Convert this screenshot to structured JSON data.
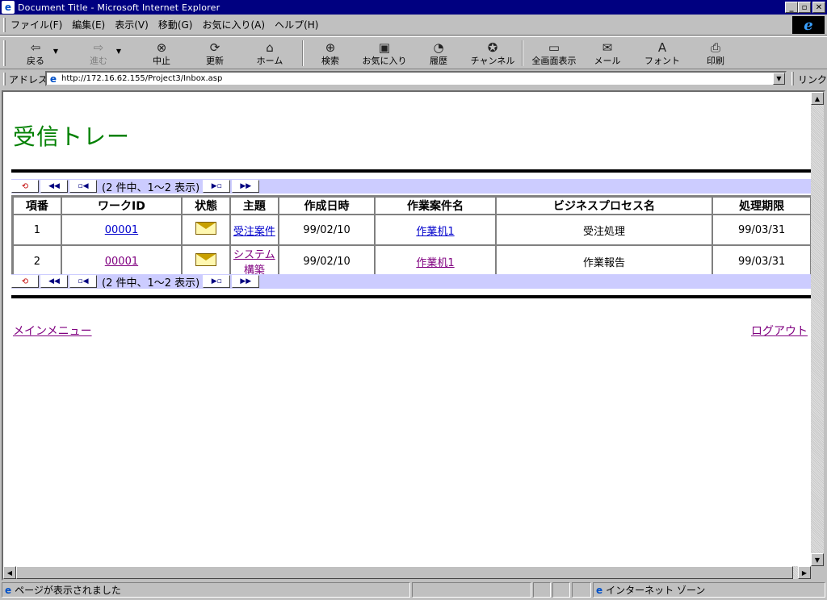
{
  "window": {
    "title": "Document Title - Microsoft Internet Explorer",
    "icon": "ie-icon"
  },
  "menubar": {
    "items": [
      "ファイル(F)",
      "編集(E)",
      "表示(V)",
      "移動(G)",
      "お気に入り(A)",
      "ヘルプ(H)"
    ]
  },
  "toolbar": {
    "back": "戻る",
    "forward": "進む",
    "stop": "中止",
    "refresh": "更新",
    "home": "ホーム",
    "search": "検索",
    "favorites": "お気に入り",
    "history": "履歴",
    "channels": "チャンネル",
    "fullscreen": "全画面表示",
    "mail": "メール",
    "fonts": "フォント",
    "print": "印刷"
  },
  "addressbar": {
    "label": "アドレス",
    "url": "http://172.16.62.155/Project3/Inbox.asp",
    "links_label": "リンク"
  },
  "page": {
    "title": "受信トレー",
    "pager_info": "(2 件中、1〜2 表示)",
    "columns": [
      "項番",
      "ワークID",
      "状態",
      "主題",
      "作成日時",
      "作業案件名",
      "ビジネスプロセス名",
      "処理期限"
    ],
    "rows": [
      {
        "no": "1",
        "work_id": "00001",
        "subject": "受注案件",
        "created": "99/02/10",
        "task": "作業机1",
        "process": "受注処理",
        "deadline": "99/03/31"
      },
      {
        "no": "2",
        "work_id": "00001",
        "subject": "システム構築",
        "created": "99/02/10",
        "task": "作業机1",
        "process": "作業報告",
        "deadline": "99/03/31"
      }
    ],
    "main_menu_link": "メインメニュー",
    "logout_link": "ログアウト"
  },
  "statusbar": {
    "message": "ページが表示されました",
    "zone": "インターネット ゾーン"
  }
}
